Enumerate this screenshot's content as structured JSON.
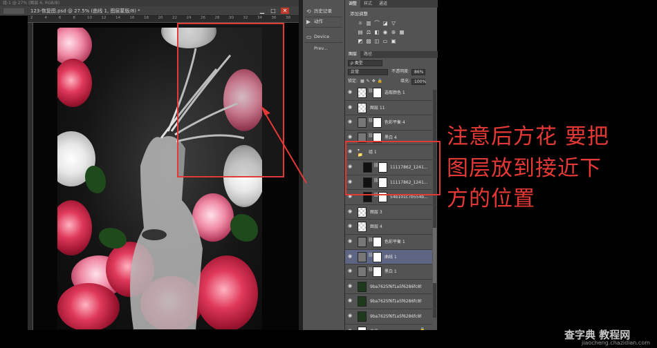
{
  "app": {
    "top_strip": "组-1 @ 27% (图层 6, RGB/8)",
    "doc_tab": "123-恢复图.psd @ 27.5% (曲线 1, 图层蒙版/8) *"
  },
  "ruler_ticks": [
    "2",
    "4",
    "6",
    "8",
    "10",
    "12",
    "14",
    "16",
    "18",
    "20",
    "22",
    "24",
    "26",
    "28",
    "30",
    "32",
    "34",
    "36",
    "38"
  ],
  "middle_panel": {
    "history_label": "历史记录",
    "actions_label": "动作",
    "device_label": "Device Prev..."
  },
  "adjustments_panel": {
    "tabs": [
      "调整",
      "样式",
      "通道"
    ],
    "title": "添加调整"
  },
  "layers_panel": {
    "tabs": [
      "图层",
      "路径"
    ],
    "filter_label": "ρ 类型",
    "blend_mode": "正常",
    "opacity_label": "不透明度:",
    "opacity_value": "86%",
    "lock_label": "锁定:",
    "fill_label": "填充:",
    "fill_value": "100%",
    "layers": [
      {
        "name": "选取颜色 1",
        "thumb": "chk",
        "mask": true
      },
      {
        "name": "图层 11",
        "thumb": "chk",
        "mask": false
      },
      {
        "name": "色彩平衡 4",
        "thumb": "adj",
        "mask": true
      },
      {
        "name": "黑白 4",
        "thumb": "adj",
        "mask": true
      },
      {
        "name": "组 1",
        "thumb": "folder",
        "mask": false
      },
      {
        "name": "11117862_1241...",
        "thumb": "sil",
        "mask": true
      },
      {
        "name": "11117862_1241...",
        "thumb": "sil",
        "mask": true
      },
      {
        "name": "54b101c7b554b...",
        "thumb": "sil",
        "mask": true
      },
      {
        "name": "图层 3",
        "thumb": "chk",
        "mask": false
      },
      {
        "name": "图层 4",
        "thumb": "chk",
        "mask": false
      },
      {
        "name": "色彩平衡 1",
        "thumb": "adj",
        "mask": true
      },
      {
        "name": "曲线 1",
        "thumb": "adj",
        "mask": true
      },
      {
        "name": "黑白 1",
        "thumb": "adj",
        "mask": true
      },
      {
        "name": "9ba7625f6f1a5f6286fc8f13...",
        "thumb": "dk",
        "mask": false
      },
      {
        "name": "9ba7625f6f1a5f6286fc8f13...",
        "thumb": "dk",
        "mask": false
      },
      {
        "name": "9ba7625f6f1a5f6286fc8f13...",
        "thumb": "dk",
        "mask": false
      },
      {
        "name": "背景",
        "thumb": "white",
        "mask": false
      }
    ]
  },
  "annotation": {
    "line1": "注意后方花  要把",
    "line2": "图层放到接近下",
    "line3": "方的位置"
  },
  "watermark": {
    "brand": "查字典 教程网",
    "url": "jiaocheng.chazidian.com"
  },
  "colors": {
    "annotation_red": "#e53935",
    "panel_gray": "#535353",
    "selected_layer": "#5d6582"
  }
}
